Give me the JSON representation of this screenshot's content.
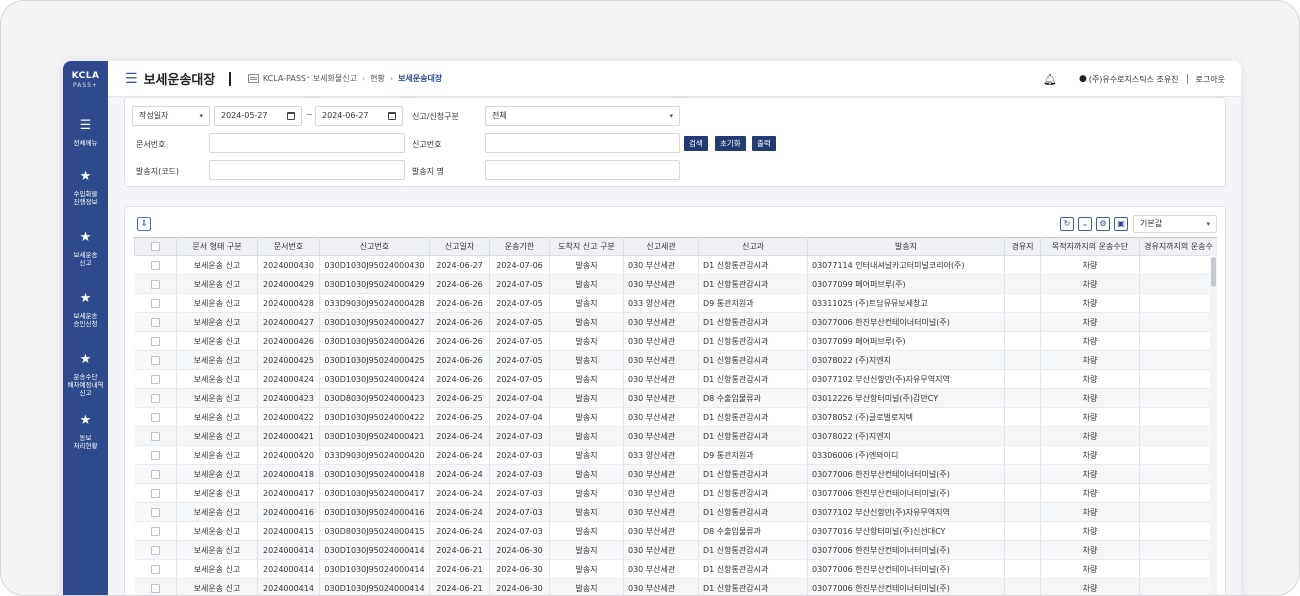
{
  "sidebar": {
    "logo_top": "KCLA",
    "logo_bottom": "PASS+",
    "menu": {
      "icon": "menu-icon",
      "label": "전체메뉴"
    },
    "items": [
      {
        "icon": "star-icon",
        "label": "수입화물\n진행정보"
      },
      {
        "icon": "star-icon",
        "label": "보세운송\n신고"
      },
      {
        "icon": "star-icon",
        "label": "보세운송\n승인신청"
      },
      {
        "icon": "star-icon",
        "label": "운송수단\n배차예정내역\n신고"
      },
      {
        "icon": "star-icon",
        "label": "동보\n처리현황"
      }
    ]
  },
  "header": {
    "title": "보세운송대장",
    "breadcrumb": [
      "KCLA-PASS⁺ 보세화물신고",
      "현황",
      "보세운송대장"
    ],
    "user": "(주)유수로지스틱스 조유진",
    "logout": "로그아웃"
  },
  "search": {
    "date_type": "작성일자",
    "date_from": "2024-05-27",
    "date_sep": "~",
    "date_to": "2024-06-27",
    "report_type_label": "신고/신청구분",
    "report_type_value": "전체",
    "doc_no_label": "문서번호",
    "doc_no_value": "",
    "report_no_label": "신고번호",
    "report_no_value": "",
    "sender_code_label": "발송지(코드)",
    "sender_code_value": "",
    "sender_name_label": "발송지 명",
    "sender_name_value": "",
    "btn_search": "검색",
    "btn_reset": "초기화",
    "btn_print": "출력"
  },
  "grid": {
    "view_select": "기본값",
    "columns": [
      "",
      "문서 형태 구분",
      "문서번호",
      "신고번호",
      "신고일자",
      "운송기한",
      "도착지 신고 구분",
      "신고세관",
      "신고과",
      "발송지",
      "경유지",
      "목적지까지의 운송수단",
      "경유지까지의 운송수"
    ],
    "rows": [
      [
        "보세운송 신고",
        "2024000430",
        "030D1030J95024000430",
        "2024-06-27",
        "2024-07-06",
        "발송지",
        "030 부산세관",
        "D1 신항통관감시과",
        "03077114 인터내셔널카고터미널코리아(주)",
        "",
        "차량"
      ],
      [
        "보세운송 신고",
        "2024000429",
        "030D1030J95024000429",
        "2024-06-26",
        "2024-07-05",
        "발송지",
        "030 부산세관",
        "D1 신항통관감시과",
        "03077099 페어퍼브루(주)",
        "",
        "차량"
      ],
      [
        "보세운송 신고",
        "2024000428",
        "033D9030J95024000428",
        "2024-06-26",
        "2024-07-05",
        "발송지",
        "033 양산세관",
        "D9 통관지원과",
        "03311025 (주)트담뮤뮤보세창고",
        "",
        "차량"
      ],
      [
        "보세운송 신고",
        "2024000427",
        "030D1030J95024000427",
        "2024-06-26",
        "2024-07-05",
        "발송지",
        "030 부산세관",
        "D1 신항통관감시과",
        "03077006 한진부산컨테이너터미널(주)",
        "",
        "차량"
      ],
      [
        "보세운송 신고",
        "2024000426",
        "030D1030J95024000426",
        "2024-06-26",
        "2024-07-05",
        "발송지",
        "030 부산세관",
        "D1 신항통관감시과",
        "03077099 페어퍼브루(주)",
        "",
        "차량"
      ],
      [
        "보세운송 신고",
        "2024000425",
        "030D1030J95024000425",
        "2024-06-26",
        "2024-07-05",
        "발송지",
        "030 부산세관",
        "D1 신항통관감시과",
        "03078022 (주)지엔지",
        "",
        "차량"
      ],
      [
        "보세운송 신고",
        "2024000424",
        "030D1030J95024000424",
        "2024-06-26",
        "2024-07-05",
        "발송지",
        "030 부산세관",
        "D1 신항통관감시과",
        "03077102 부산신항만(주)자유무역지역",
        "",
        "차량"
      ],
      [
        "보세운송 신고",
        "2024000423",
        "030D8030J95024000423",
        "2024-06-25",
        "2024-07-04",
        "발송지",
        "030 부산세관",
        "D8 수출입물류과",
        "03012226 부산항터미널(주)감만CY",
        "",
        "차량"
      ],
      [
        "보세운송 신고",
        "2024000422",
        "030D1030J95024000422",
        "2024-06-25",
        "2024-07-04",
        "발송지",
        "030 부산세관",
        "D1 신항통관감시과",
        "03078052 (주)글로벌로지텍",
        "",
        "차량"
      ],
      [
        "보세운송 신고",
        "2024000421",
        "030D1030J95024000421",
        "2024-06-24",
        "2024-07-03",
        "발송지",
        "030 부산세관",
        "D1 신항통관감시과",
        "03078022 (주)지엔지",
        "",
        "차량"
      ],
      [
        "보세운송 신고",
        "2024000420",
        "033D9030J95024000420",
        "2024-06-24",
        "2024-07-03",
        "발송지",
        "033 양산세관",
        "D9 통관지원과",
        "03306006 (주)엔와이디",
        "",
        "차량"
      ],
      [
        "보세운송 신고",
        "2024000418",
        "030D1030J95024000418",
        "2024-06-24",
        "2024-07-03",
        "발송지",
        "030 부산세관",
        "D1 신항통관감시과",
        "03077006 한진부산컨테이너터미널(주)",
        "",
        "차량"
      ],
      [
        "보세운송 신고",
        "2024000417",
        "030D1030J95024000417",
        "2024-06-24",
        "2024-07-03",
        "발송지",
        "030 부산세관",
        "D1 신항통관감시과",
        "03077006 한진부산컨테이너터미널(주)",
        "",
        "차량"
      ],
      [
        "보세운송 신고",
        "2024000416",
        "030D1030J95024000416",
        "2024-06-24",
        "2024-07-03",
        "발송지",
        "030 부산세관",
        "D1 신항통관감시과",
        "03077102 부산신항만(주)자유무역지역",
        "",
        "차량"
      ],
      [
        "보세운송 신고",
        "2024000415",
        "030D8030J95024000415",
        "2024-06-24",
        "2024-07-03",
        "발송지",
        "030 부산세관",
        "D8 수출입물류과",
        "03077016 부산항터미널(주)신선대CY",
        "",
        "차량"
      ],
      [
        "보세운송 신고",
        "2024000414",
        "030D1030J95024000414",
        "2024-06-21",
        "2024-06-30",
        "발송지",
        "030 부산세관",
        "D1 신항통관감시과",
        "03077006 한진부산컨테이너터미널(주)",
        "",
        "차량"
      ],
      [
        "보세운송 신고",
        "2024000414",
        "030D1030J95024000414",
        "2024-06-21",
        "2024-06-30",
        "발송지",
        "030 부산세관",
        "D1 신항통관감시과",
        "03077006 한진부산컨테이너터미널(주)",
        "",
        "차량"
      ],
      [
        "보세운송 신고",
        "2024000414",
        "030D1030J95024000414",
        "2024-06-21",
        "2024-06-30",
        "발송지",
        "030 부산세관",
        "D1 신항통관감시과",
        "03077006 한진부산컨테이너터미널(주)",
        "",
        "차량"
      ]
    ]
  },
  "colors": {
    "sidebar": "#2f4a8c",
    "button": "#243a73",
    "accent": "#3a57a5"
  }
}
